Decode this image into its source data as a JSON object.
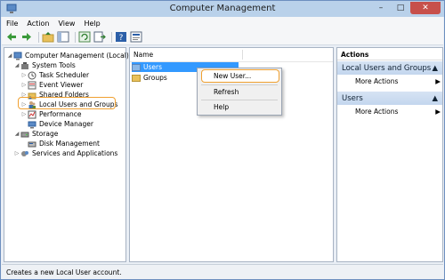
{
  "window": {
    "title": "Computer Management",
    "minimize": "–",
    "maximize": "□",
    "close": "✕"
  },
  "menu": [
    "File",
    "Action",
    "View",
    "Help"
  ],
  "tree": {
    "root": "Computer Management (Local)",
    "system_tools": "System Tools",
    "task_scheduler": "Task Scheduler",
    "event_viewer": "Event Viewer",
    "shared_folders": "Shared Folders",
    "local_users": "Local Users and Groups",
    "performance": "Performance",
    "device_manager": "Device Manager",
    "storage": "Storage",
    "disk_management": "Disk Management",
    "services": "Services and Applications"
  },
  "list": {
    "column_name": "Name",
    "items": [
      "Users",
      "Groups"
    ]
  },
  "context_menu": {
    "new_user": "New User...",
    "refresh": "Refresh",
    "help": "Help"
  },
  "actions": {
    "header": "Actions",
    "section1": "Local Users and Groups",
    "section1_more": "More Actions",
    "section2": "Users",
    "section2_more": "More Actions"
  },
  "status": "Creates a new Local User account."
}
